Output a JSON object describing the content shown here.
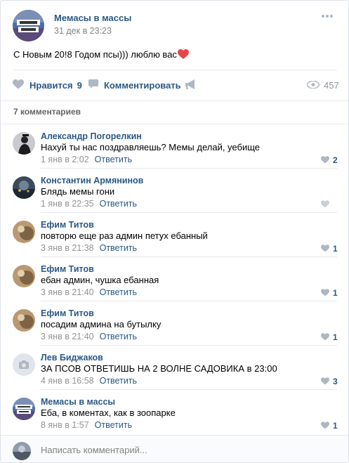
{
  "post": {
    "group_name": "Мемасы в массы",
    "date": "31 дек в 23:23",
    "text": "С Новым 20!8 Годом псы))) люблю вас",
    "like_label": "Нравится",
    "like_count": "9",
    "comment_label": "Комментировать",
    "views_count": "457"
  },
  "comments_header": "7 комментариев",
  "reply_label": "Ответить",
  "comments": [
    {
      "author": "Александр Погорелкин",
      "text": "Нахуй ты нас поздравляешь? Мемы делай, уебище",
      "time": "1 янв в 2:02",
      "likes": "2",
      "avatar": "dark-figure"
    },
    {
      "author": "Константин Армянинов",
      "text": "Блядь мемы гони",
      "time": "1 янв в 22:35",
      "likes": "",
      "avatar": "night-scene"
    },
    {
      "author": "Ефим Титов",
      "text": "повторю еще раз админ петух ебанный",
      "time": "3 янв в 21:38",
      "likes": "1",
      "avatar": "sepia-photo"
    },
    {
      "author": "Ефим Титов",
      "text": "ебан админ, чушка ебанная",
      "time": "3 янв в 21:40",
      "likes": "1",
      "avatar": "sepia-photo"
    },
    {
      "author": "Ефим Титов",
      "text": "посадим админа на бутылку",
      "time": "3 янв в 21:40",
      "likes": "1",
      "avatar": "sepia-photo"
    },
    {
      "author": "Лев Биджаков",
      "text": "ЗА ПСОВ ОТВЕТИШЬ НА 2 ВОЛНЕ САДОВИКА в 23:00",
      "time": "4 янв в 16:58",
      "likes": "3",
      "avatar": "camera-placeholder"
    },
    {
      "author": "Мемасы в массы",
      "text": "Еба, в коментах, как в зоопарке",
      "time": "8 янв в 1:57",
      "likes": "1",
      "avatar": "group-logo"
    }
  ],
  "reply_box": {
    "placeholder": "Написать комментарий..."
  },
  "colors": {
    "link": "#2a5885",
    "muted": "#939393",
    "icon": "#aeb7c2",
    "heart": "#e64646",
    "divider": "#e7e8ec"
  }
}
